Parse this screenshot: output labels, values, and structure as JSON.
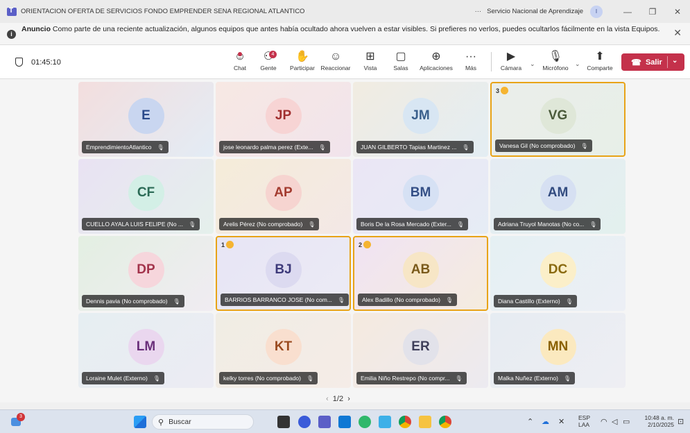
{
  "window": {
    "title": "ORIENTACION OFERTA DE SERVICIOS FONDO EMPRENDER SENA REGIONAL ATLANTICO",
    "more": "···",
    "org_name": "Servicio Nacional de Aprendizaje",
    "org_avatar": "I",
    "minimize": "—",
    "restore": "❐",
    "close": "✕"
  },
  "announcement": {
    "lead": "Anuncio",
    "text": "Como parte de una reciente actualización, algunos equipos que antes había ocultado ahora vuelven a estar visibles. Si prefieres no verlos, puedes ocultarlos fácilmente en la vista Equipos.",
    "close": "✕"
  },
  "meeting": {
    "elapsed": "01:45:10",
    "toolbar": [
      {
        "label": "Chat",
        "icon": "chat-icon",
        "glyph": "☺"
      },
      {
        "label": "Gente",
        "icon": "people-icon",
        "glyph": "⚇",
        "badge": "4"
      },
      {
        "label": "Participar",
        "icon": "hand-icon",
        "glyph": "✋"
      },
      {
        "label": "Reaccionar",
        "icon": "smile-icon",
        "glyph": "☺"
      },
      {
        "label": "Vista",
        "icon": "grid-icon",
        "glyph": "⊞"
      },
      {
        "label": "Salas",
        "icon": "rooms-icon",
        "glyph": "▢"
      },
      {
        "label": "Aplicaciones",
        "icon": "apps-icon",
        "glyph": "⊕"
      },
      {
        "label": "Más",
        "icon": "more-icon",
        "glyph": "···"
      }
    ],
    "devices": [
      {
        "label": "Cámara",
        "icon": "camera-off-icon",
        "glyph": "▶"
      },
      {
        "label": "Micrófono",
        "icon": "mic-off-icon",
        "glyph": "🎙"
      },
      {
        "label": "Comparte",
        "icon": "share-icon",
        "glyph": "⬆"
      }
    ],
    "leave_label": "Salir",
    "pager": {
      "prev": "‹",
      "current": "1/2",
      "next": "›"
    }
  },
  "participants": [
    {
      "initials": "E",
      "name": "EmprendimientoAtlantico",
      "avatar_bg": "#c9d6f0",
      "avatar_fg": "#2b4a8a",
      "tile_bg": "linear-gradient(135deg,#f3dede,#e3ecf5)"
    },
    {
      "initials": "JP",
      "name": "jose leonardo palma perez (Exte...",
      "avatar_bg": "#f7d4d4",
      "avatar_fg": "#a12f2f",
      "tile_bg": "linear-gradient(135deg,#f7e8e3,#f1e4ec)"
    },
    {
      "initials": "JM",
      "name": "JUAN GILBERTO Tapias Martinez ...",
      "avatar_bg": "#d8e6f3",
      "avatar_fg": "#3a5f8c",
      "tile_bg": "linear-gradient(135deg,#f1ece1,#e3edf3)"
    },
    {
      "initials": "VG",
      "name": "Vanesa Gil (No comprobado)",
      "avatar_bg": "#dfe7d8",
      "avatar_fg": "#4a5a3a",
      "tile_bg": "linear-gradient(135deg,#ebeeea,#e7efe8)",
      "hand": "3"
    },
    {
      "initials": "CF",
      "name": "CUELLO AYALA LUIS FELIPE (No ...",
      "avatar_bg": "#d3efe6",
      "avatar_fg": "#2b6b56",
      "tile_bg": "linear-gradient(135deg,#e9e2f3,#e5f0ec)"
    },
    {
      "initials": "AP",
      "name": "Arelis Pérez (No comprobado)",
      "avatar_bg": "#f6d4d0",
      "avatar_fg": "#a33b2f",
      "tile_bg": "linear-gradient(135deg,#f5ecd9,#f3e8e6)"
    },
    {
      "initials": "BM",
      "name": "Boris De la Rosa Mercado (Exter...",
      "avatar_bg": "#d6e1f4",
      "avatar_fg": "#344f86",
      "tile_bg": "linear-gradient(135deg,#ebe6f5,#e6ecf5)"
    },
    {
      "initials": "AM",
      "name": "Adriana Truyol Manotas (No co...",
      "avatar_bg": "#d6e0f2",
      "avatar_fg": "#334c80",
      "tile_bg": "linear-gradient(135deg,#e5ecf3,#e3f0ee)"
    },
    {
      "initials": "DP",
      "name": "Dennis pavia (No comprobado)",
      "avatar_bg": "#f6d6dc",
      "avatar_fg": "#a3334b",
      "tile_bg": "linear-gradient(135deg,#e3efe2,#f0ecf2)"
    },
    {
      "initials": "BJ",
      "name": "BARRIOS BARRANCO JOSE (No com...",
      "avatar_bg": "#dcdaf0",
      "avatar_fg": "#3d3a7a",
      "tile_bg": "linear-gradient(135deg,#e7e5f5,#ecebf5)",
      "hand": "1"
    },
    {
      "initials": "AB",
      "name": "Alex Badillo (No comprobado)",
      "avatar_bg": "#f7e6c6",
      "avatar_fg": "#7a5a1a",
      "tile_bg": "linear-gradient(135deg,#f0e3f3,#f5ecdf)",
      "hand": "2"
    },
    {
      "initials": "DC",
      "name": "Diana Castillo (Externo)",
      "avatar_bg": "#fbefc9",
      "avatar_fg": "#8a6a10",
      "tile_bg": "linear-gradient(135deg,#e5f0f3,#eceff5)"
    },
    {
      "initials": "LM",
      "name": "Loraine Mulet (Externo)",
      "avatar_bg": "#ead7ef",
      "avatar_fg": "#6a2f7a",
      "tile_bg": "linear-gradient(135deg,#e6eef2,#ececf3)"
    },
    {
      "initials": "KT",
      "name": "kelky torres (No comprobado)",
      "avatar_bg": "#f9dfcf",
      "avatar_fg": "#9a4a1f",
      "tile_bg": "linear-gradient(135deg,#f0ede4,#f5ece7)"
    },
    {
      "initials": "ER",
      "name": "Emilia Niño Restrepo (No compr...",
      "avatar_bg": "#e2e2ea",
      "avatar_fg": "#3f3f5a",
      "tile_bg": "linear-gradient(135deg,#f5eadf,#eceaf0)"
    },
    {
      "initials": "MN",
      "name": "Malka Nuñez (Externo)",
      "avatar_bg": "#fbe9bf",
      "avatar_fg": "#8a6000",
      "tile_bg": "linear-gradient(135deg,#e6ecf2,#eeeef3)"
    }
  ],
  "taskbar": {
    "notification_badge": "3",
    "search_placeholder": "Buscar",
    "pinned": [
      "file-explorer-icon",
      "meet-icon",
      "teams-icon",
      "outlook-icon",
      "app-icon",
      "store-icon",
      "chrome-icon",
      "folder-icon",
      "chrome-profile-icon"
    ],
    "language_top": "ESP",
    "language_bottom": "LAA",
    "time": "10:48 a. m.",
    "date": "2/10/2025"
  }
}
